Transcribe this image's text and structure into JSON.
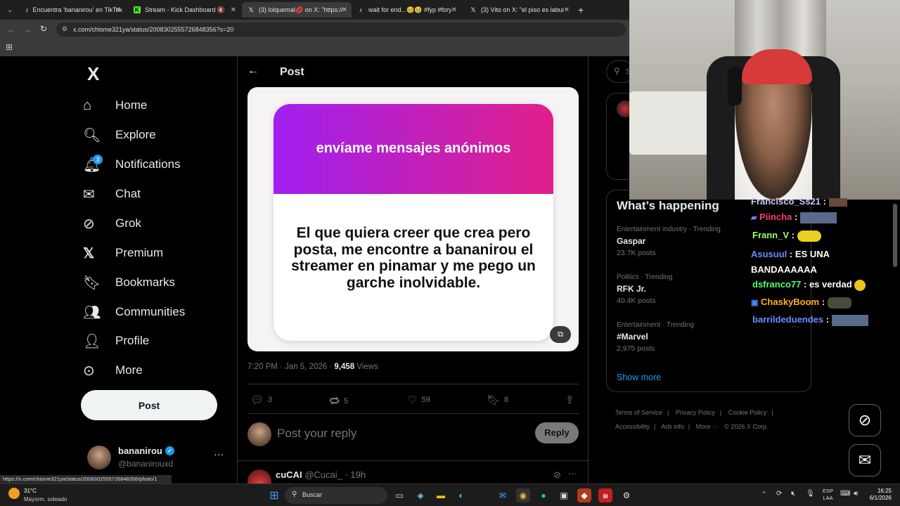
{
  "browser": {
    "tabs": [
      {
        "icon": "tiktok-icon",
        "label": "Encuentra 'bananirou' en TikTok"
      },
      {
        "icon": "kick-icon",
        "label": "Stream - Kick Dashboard"
      },
      {
        "icon": "x-icon",
        "label": "(3) lolquemal💋 on X: \"https://"
      },
      {
        "icon": "tiktok-icon",
        "label": "wait for end...🥹🥹 #fyp #fory"
      },
      {
        "icon": "x-icon",
        "label": "(3) Vito on X: \"el piso es laburo"
      }
    ],
    "url": "x.com/chisme321ya/status/2008302555726848356?s=20",
    "status_url": "https://x.com/chisme321ya/status/2008302555726848356/photo/1"
  },
  "nav": {
    "logo": "X",
    "items": [
      {
        "icon": "home-icon",
        "label": "Home"
      },
      {
        "icon": "explore-icon",
        "label": "Explore"
      },
      {
        "icon": "notifications-icon",
        "label": "Notifications",
        "badge": "3"
      },
      {
        "icon": "chat-icon",
        "label": "Chat"
      },
      {
        "icon": "grok-icon",
        "label": "Grok"
      },
      {
        "icon": "premium-icon",
        "label": "Premium"
      },
      {
        "icon": "bookmarks-icon",
        "label": "Bookmarks"
      },
      {
        "icon": "communities-icon",
        "label": "Communities"
      },
      {
        "icon": "profile-icon",
        "label": "Profile"
      },
      {
        "icon": "more-icon",
        "label": "More"
      }
    ],
    "post_button": "Post",
    "account": {
      "name": "bananirou",
      "handle": "@bananirouxd",
      "verified": true
    }
  },
  "post": {
    "header_title": "Post",
    "image": {
      "header": "envíame mensajes anónimos",
      "message": "El que quiera creer que crea pero posta, me encontre a bananirou el streamer en pinamar y me pego un garche inolvidable."
    },
    "meta_time": "7:20 PM · Jan 5, 2026 · ",
    "views_count": "9,458",
    "views_label": " Views",
    "stats": {
      "replies": "3",
      "reposts": "5",
      "likes": "59",
      "bookmarks": "8"
    },
    "reply_placeholder": "Post your reply",
    "reply_button": "Reply",
    "next_reply": {
      "name": "cuCAI",
      "handle": "@Cucai_ · 19h"
    }
  },
  "right": {
    "search_placeholder": "S",
    "whats_happening_title": "What’s happening",
    "trends": [
      {
        "context": "Entertainment industry · Trending",
        "name": "Gaspar",
        "count": "23.7K posts"
      },
      {
        "context": "Politics · Trending",
        "name": "RFK Jr.",
        "count": "40.4K posts"
      },
      {
        "context": "Entertainment · Trending",
        "name": "#Marvel",
        "count": "2,975 posts"
      }
    ],
    "show_more": "Show more",
    "footer": {
      "links": [
        "Terms of Service",
        "Privacy Policy",
        "Cookie Policy",
        "Accessibility",
        "Ads info",
        "More ···"
      ],
      "copyright": "© 2026 X Corp."
    }
  },
  "chat_overlay": [
    {
      "user": "Francisco_Ss21",
      "message": ":",
      "color": "#c9c9ff"
    },
    {
      "user": "Piincha",
      "message": ":",
      "color": "#ff3b6b"
    },
    {
      "user": "Frann_V",
      "message": ":",
      "color": "#9cff6b"
    },
    {
      "user": "Asusuul",
      "message": ": ES UNA BANDAAAAAA",
      "color": "#6b8cff"
    },
    {
      "user": "dsfranco77",
      "message": ": es verdad",
      "color": "#52ff6b"
    },
    {
      "user": "ChaskyBoom",
      "message": ":",
      "color": "#ffb020"
    },
    {
      "user": "barrildeduendes",
      "message": ":",
      "color": "#6b8cff"
    }
  ],
  "taskbar": {
    "weather_temp": "31°C",
    "weather_desc": "Mayorm. soleado",
    "search_label": "Buscar",
    "lang_top": "ESP",
    "lang_bottom": "LAA",
    "time": "16:25",
    "date": "6/1/2026"
  },
  "colors": {
    "accent": "#1d9bf0",
    "verified": "#1d9bf0",
    "border": "#2f3336",
    "muted": "#71767b"
  }
}
